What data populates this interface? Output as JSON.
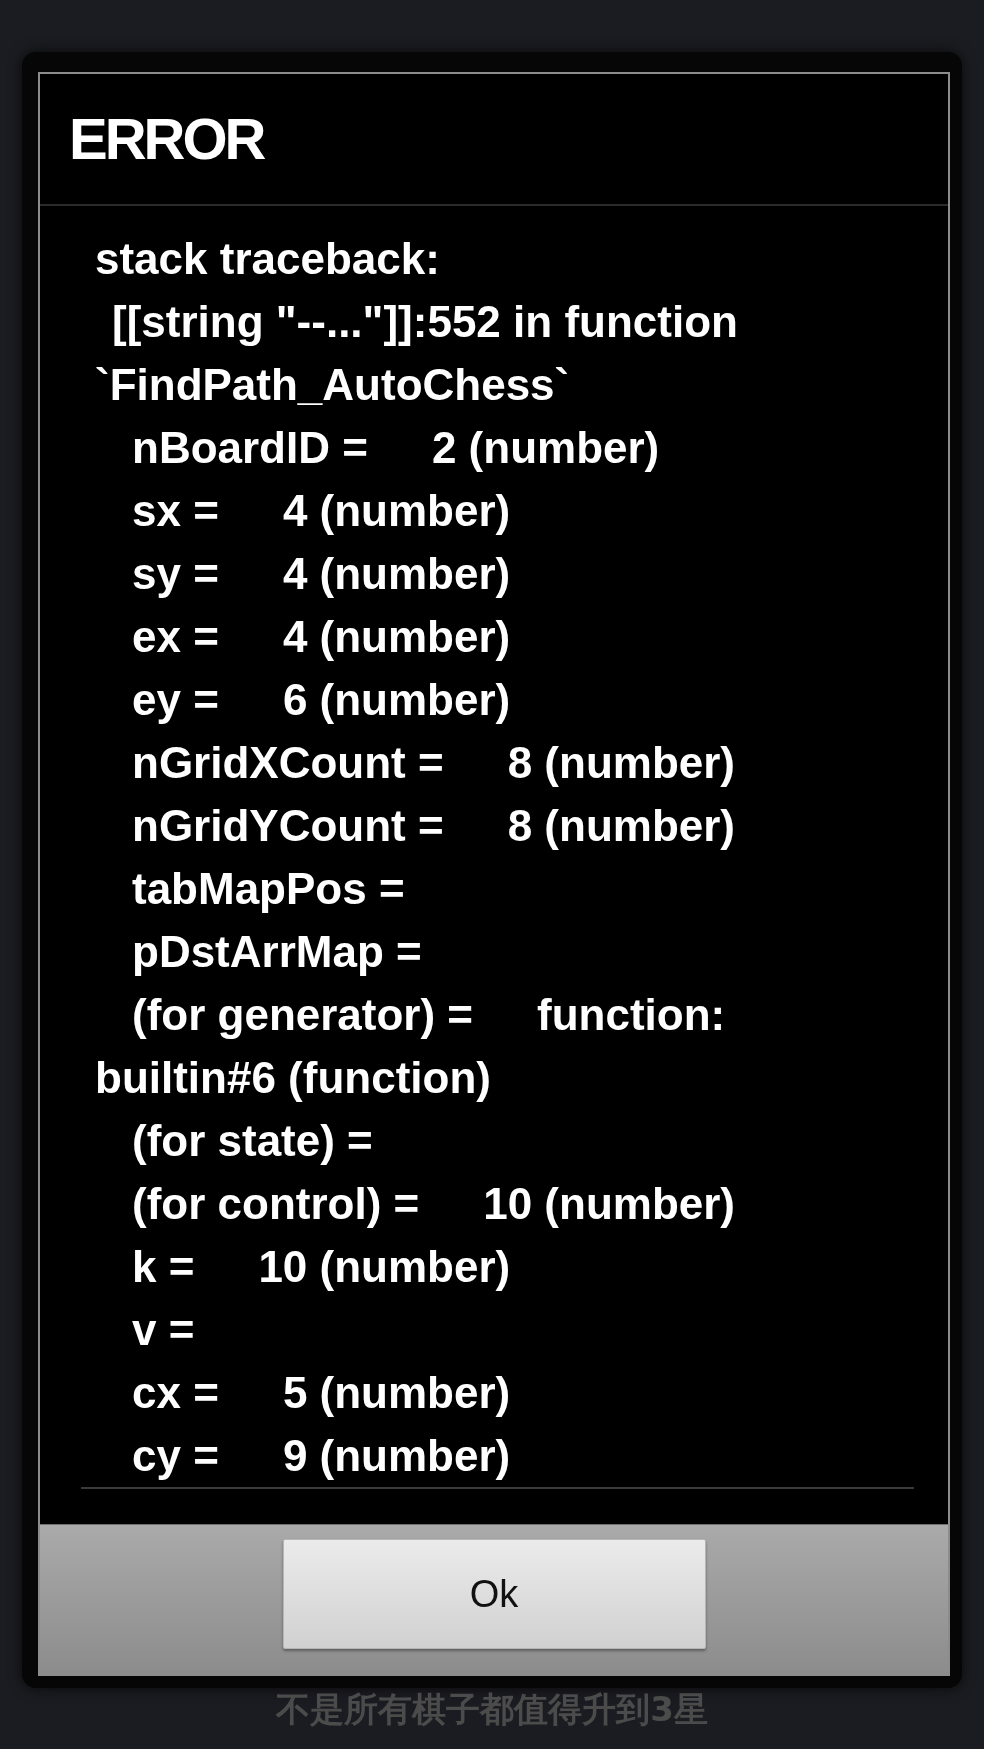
{
  "dialog": {
    "title": "ERROR",
    "trace": [
      {
        "kind": "plain",
        "text": "stack traceback:"
      },
      {
        "kind": "frame",
        "text": "[[string \"--...\"]]:552 in function"
      },
      {
        "kind": "plain",
        "text": "`FindPath_AutoChess`"
      },
      {
        "kind": "variable",
        "name": "nBoardID =",
        "value": "2 (number)"
      },
      {
        "kind": "variable",
        "name": "sx =",
        "value": "4 (number)"
      },
      {
        "kind": "variable",
        "name": "sy =",
        "value": "4 (number)"
      },
      {
        "kind": "variable",
        "name": "ex =",
        "value": "4 (number)"
      },
      {
        "kind": "variable",
        "name": "ey =",
        "value": "6 (number)"
      },
      {
        "kind": "variable",
        "name": "nGridXCount =",
        "value": "8 (number)"
      },
      {
        "kind": "variable",
        "name": "nGridYCount =",
        "value": "8 (number)"
      },
      {
        "kind": "variable",
        "name": "tabMapPos ="
      },
      {
        "kind": "variable",
        "name": "pDstArrMap ="
      },
      {
        "kind": "variable",
        "name": "(for generator) =",
        "value": "function:"
      },
      {
        "kind": "plain",
        "text": "builtin#6 (function)"
      },
      {
        "kind": "variable",
        "name": "(for state) ="
      },
      {
        "kind": "variable",
        "name": "(for control) =",
        "value": "10 (number)"
      },
      {
        "kind": "variable",
        "name": "k =",
        "value": "10 (number)"
      },
      {
        "kind": "variable",
        "name": "v ="
      },
      {
        "kind": "variable",
        "name": "cx =",
        "value": "5 (number)"
      },
      {
        "kind": "variable",
        "name": "cy =",
        "value": "9 (number)"
      }
    ],
    "buttons": [
      {
        "label": "Ok"
      }
    ]
  },
  "caption": "不是所有棋子都值得升到3星"
}
